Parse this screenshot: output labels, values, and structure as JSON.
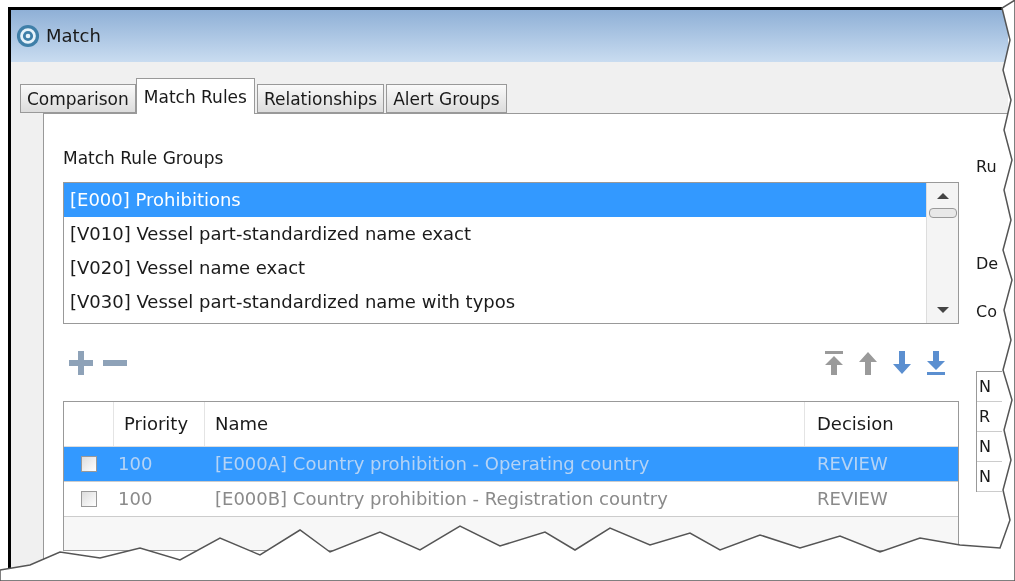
{
  "window": {
    "title": "Match"
  },
  "tabs": [
    {
      "label": "Comparison",
      "selected": false
    },
    {
      "label": "Match Rules",
      "selected": true
    },
    {
      "label": "Relationships",
      "selected": false
    },
    {
      "label": "Alert Groups",
      "selected": false
    }
  ],
  "groups": {
    "label": "Match Rule Groups",
    "items": [
      {
        "label": "[E000] Prohibitions",
        "selected": true
      },
      {
        "label": "[V010] Vessel part-standardized name exact",
        "selected": false
      },
      {
        "label": "[V020] Vessel name exact",
        "selected": false
      },
      {
        "label": "[V030] Vessel part-standardized name with typos",
        "selected": false
      }
    ]
  },
  "edit_buttons": [
    {
      "kind": "add",
      "disabled": false
    },
    {
      "kind": "remove",
      "disabled": false
    }
  ],
  "move_buttons": [
    {
      "kind": "top",
      "disabled": true
    },
    {
      "kind": "up",
      "disabled": true
    },
    {
      "kind": "down",
      "disabled": false
    },
    {
      "kind": "bottom",
      "disabled": false
    }
  ],
  "rules": {
    "columns": [
      "Priority",
      "Name",
      "Decision"
    ],
    "rows": [
      {
        "checked": false,
        "disabled": true,
        "selected": true,
        "priority": "100",
        "name": "[E000A] Country prohibition - Operating country",
        "decision": "REVIEW"
      },
      {
        "checked": false,
        "disabled": true,
        "selected": false,
        "priority": "100",
        "name": "[E000B] Country prohibition - Registration country",
        "decision": "REVIEW"
      }
    ]
  },
  "side_labels": [
    "Ru",
    "De",
    "Co"
  ],
  "side_cells": [
    "N",
    "R",
    "N",
    "N"
  ]
}
